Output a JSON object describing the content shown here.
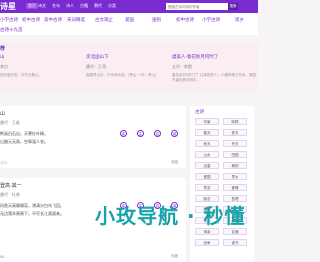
{
  "topbar": {
    "site": "诗星",
    "nav": [
      "首页",
      "诗文",
      "名句",
      "诗人",
      "古籍",
      "朝代",
      "分类"
    ],
    "search_placeholder": "搜索古诗词诗句作者",
    "search_button": "搜索"
  },
  "categories": {
    "row1": [
      "小学古诗",
      "初中古诗",
      "高中古诗",
      "宋词精选",
      "古文观止",
      "爱国",
      "送别",
      "初中古诗",
      "小学古诗",
      "思乡"
    ],
    "row2": [
      "古诗十九首"
    ]
  },
  "recommend": {
    "title": "荐",
    "items": [
      {
        "title": "山",
        "author": "李白",
        "desc": "西北望长安，可怜无数山。"
      },
      {
        "title": "次北固山下",
        "author": "唐代 · 王湾",
        "desc": "客路青山外，行舟绿水前。(青山 一作：青山)"
      },
      {
        "title": "虞美人·春花秋月何时了",
        "author": "五代 · 李煜",
        "desc": "春花秋月何时了？往事知多少。小楼昨夜又东风，故国不堪回首月明中。"
      }
    ]
  },
  "cards": [
    {
      "title": "山",
      "author": "唐代 · 王维",
      "lines": [
        "荆溪白石出，天寒红叶稀。",
        "山路元无雨，空翠湿人衣。"
      ],
      "tools": [
        "译",
        "注",
        "赏",
        "读"
      ],
      "count": "123",
      "like": "收藏"
    },
    {
      "title": "登高·其一",
      "author": "唐代 · 杜甫",
      "lines": [
        "风急天高猿啸哀，渚清沙白鸟飞回。",
        "无边落木萧萧下，不尽长江滚滚来。"
      ],
      "tools": [
        "译",
        "注",
        "赏",
        "读"
      ],
      "count": "88",
      "like": "收藏"
    }
  ],
  "sidebar": {
    "head": "古诗",
    "tags": [
      "写景",
      "咏物",
      "春天",
      "夏天",
      "秋天",
      "冬天",
      "山水",
      "田园",
      "边塞",
      "离别",
      "爱国",
      "思乡",
      "思念",
      "爱情",
      "励志",
      "哲理",
      "闺怨",
      "悼亡",
      "写人",
      "老师",
      "母亲",
      "友情",
      "战争",
      "读书"
    ]
  },
  "watermark": "小玫导航 · 秒懂"
}
